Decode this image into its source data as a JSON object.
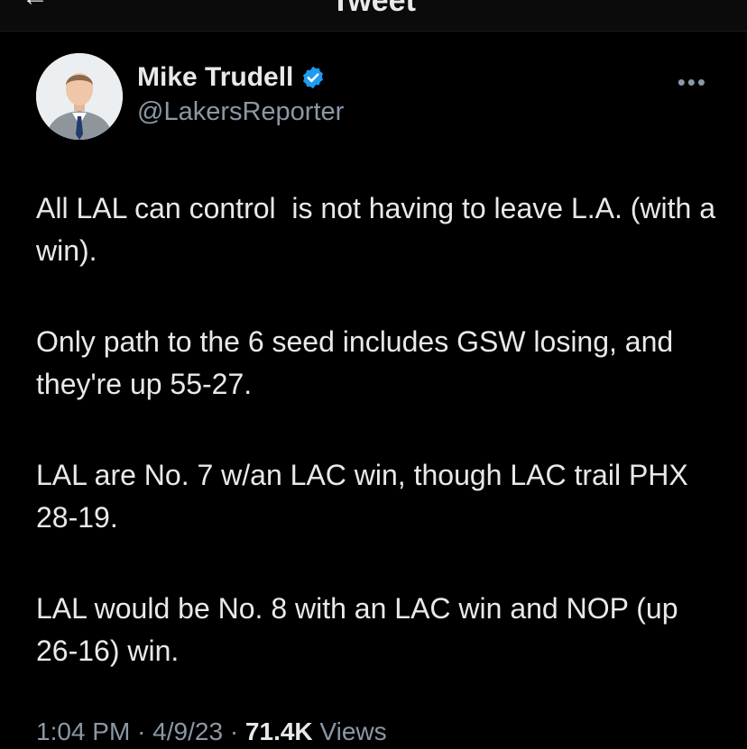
{
  "header": {
    "title": "Tweet",
    "back_icon": "arrow-left-icon"
  },
  "author": {
    "name": "Mike Trudell",
    "handle": "@LakersReporter",
    "verified_icon": "verified-badge-icon",
    "verified_color": "#1d9bf0"
  },
  "more_menu": {
    "label": "•••",
    "icon": "more-icon"
  },
  "tweet": {
    "paragraphs": [
      "All LAL can control  is not having to leave L.A. (with a win).",
      "Only path to the 6 seed includes GSW losing, and they're up 55-27.",
      "LAL are No. 7 w/an LAC win, though LAC trail PHX 28-19.",
      "LAL would be No. 8 with an LAC win and NOP (up 26-16) win."
    ]
  },
  "meta": {
    "time": "1:04 PM",
    "separator": "·",
    "date": "4/9/23",
    "views_count": "71.4K",
    "views_label": "Views"
  }
}
